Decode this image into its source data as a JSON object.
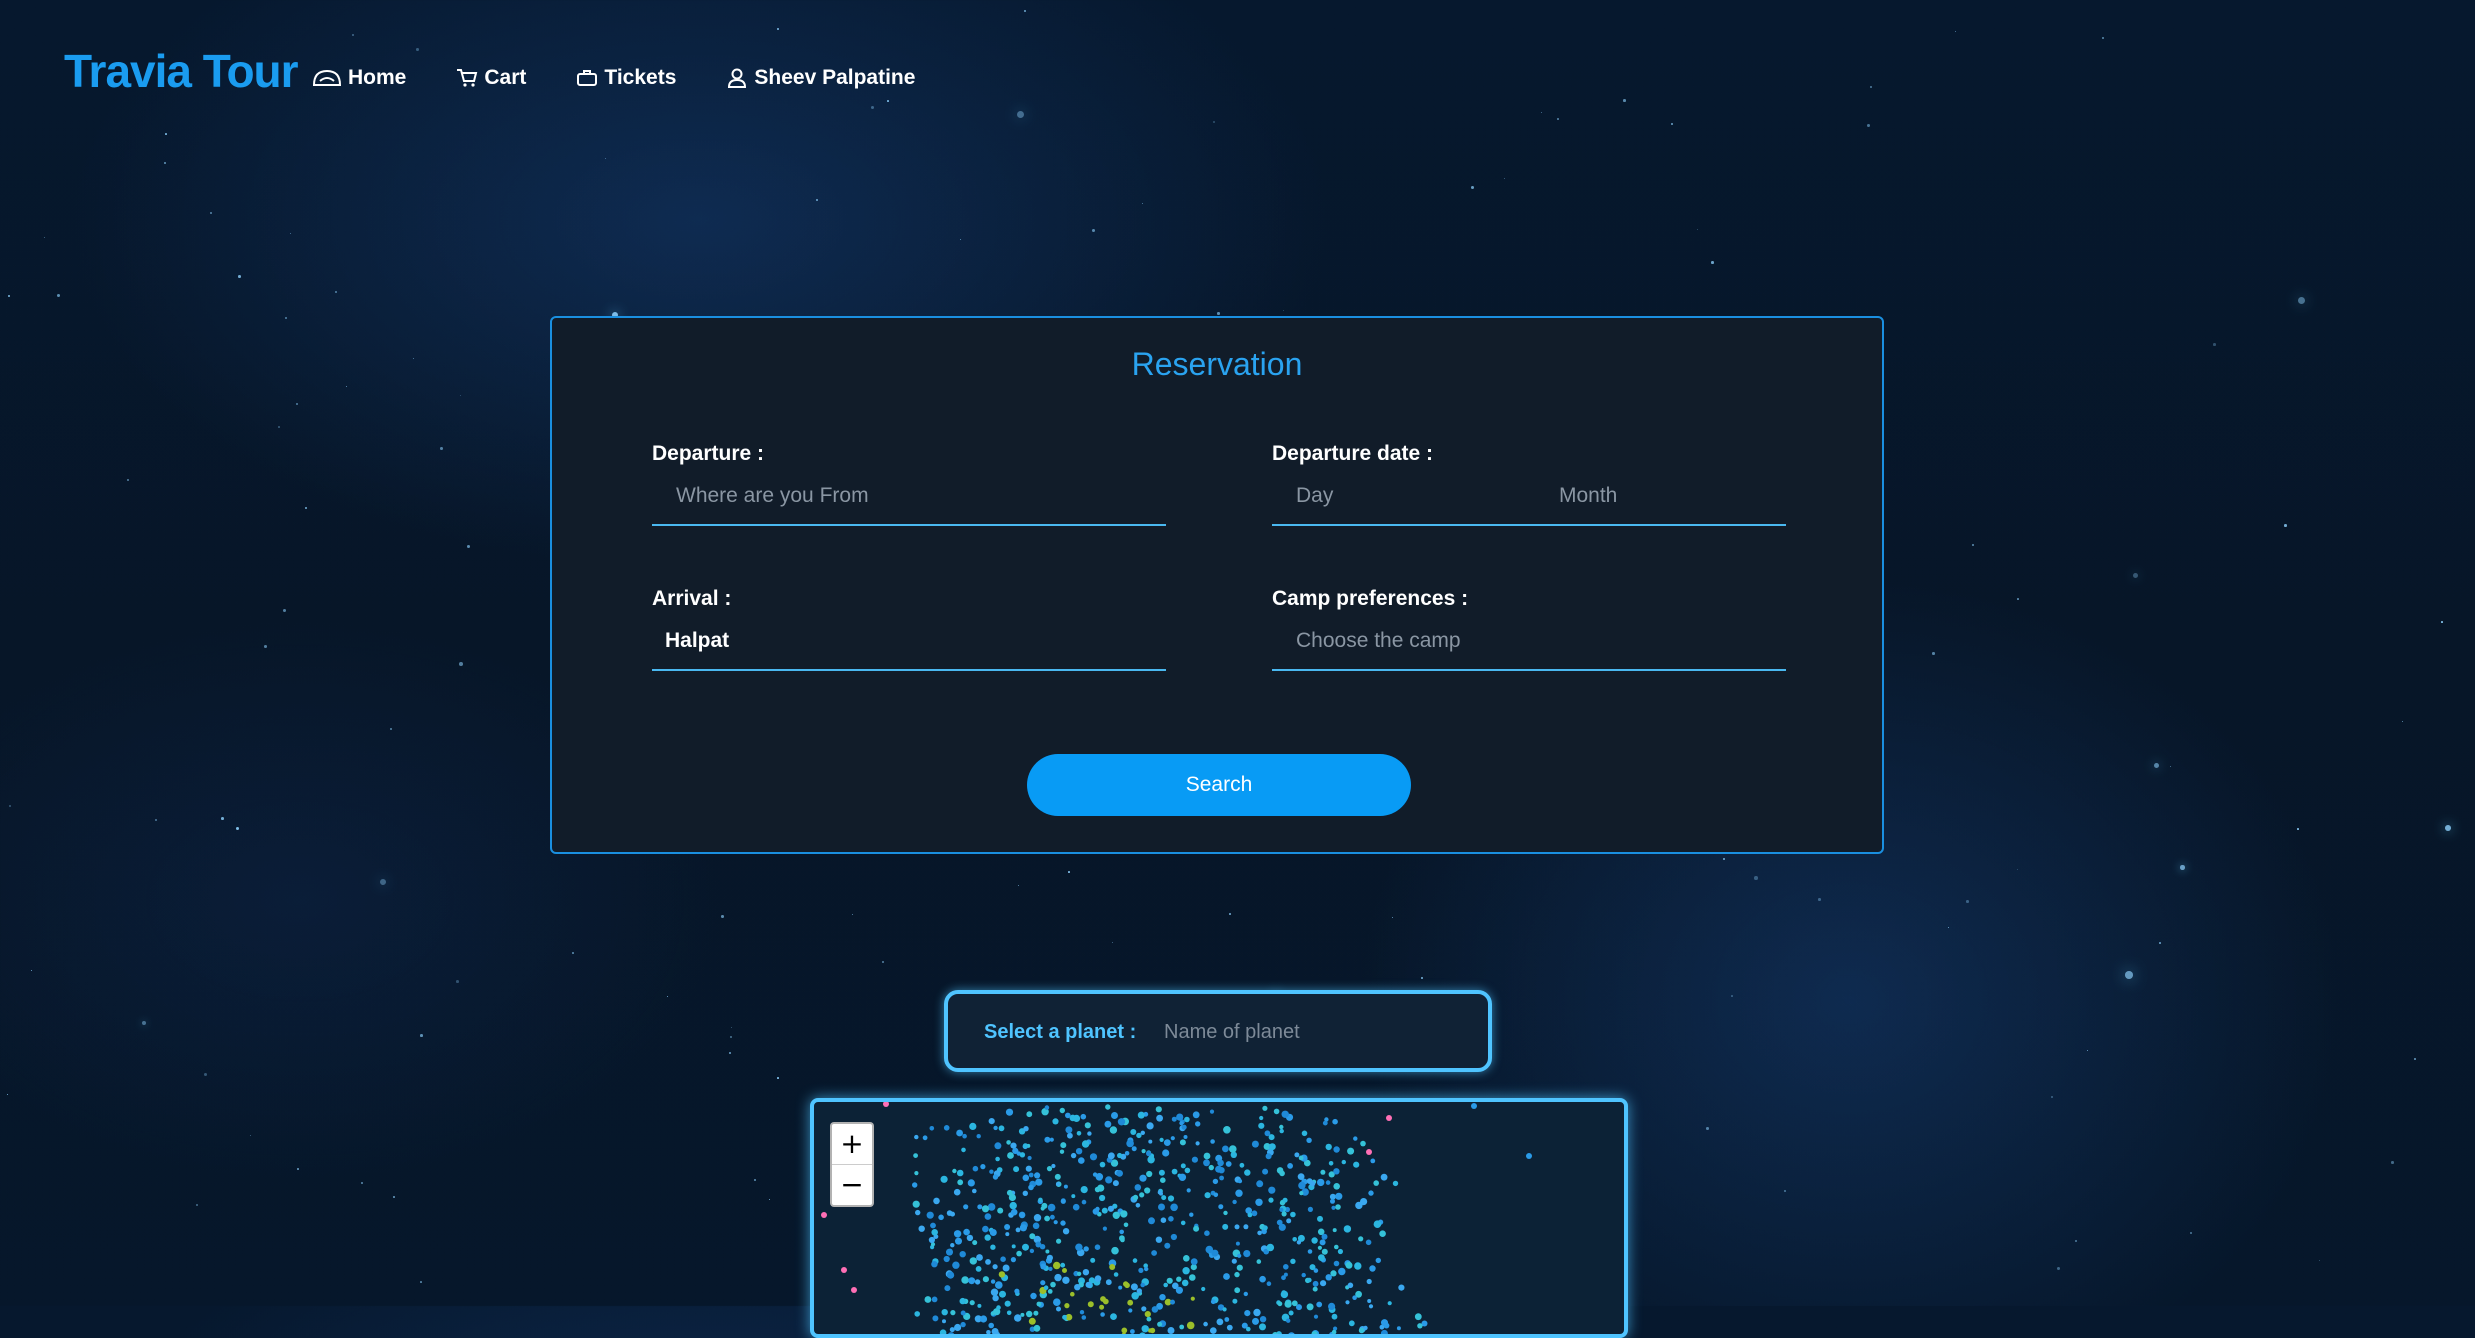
{
  "brand": {
    "name": "Travia Tour"
  },
  "nav": [
    {
      "label": "Home",
      "icon": "helmet-icon"
    },
    {
      "label": "Cart",
      "icon": "cart-icon"
    },
    {
      "label": "Tickets",
      "icon": "briefcase-icon"
    },
    {
      "label": "Sheev Palpatine",
      "icon": "user-icon"
    }
  ],
  "reservation": {
    "title": "Reservation",
    "departure": {
      "label": "Departure :",
      "placeholder": "Where are you From"
    },
    "departure_date": {
      "label": "Departure date :",
      "day_placeholder": "Day",
      "month_placeholder": "Month"
    },
    "arrival": {
      "label": "Arrival :",
      "value": "Halpat"
    },
    "camp": {
      "label": "Camp preferences :",
      "placeholder": "Choose the camp"
    },
    "search_label": "Search"
  },
  "planet_select": {
    "label": "Select a planet :",
    "placeholder": "Name of planet"
  },
  "map": {
    "zoom_in": "+",
    "zoom_out": "−"
  },
  "colors": {
    "accent": "#1a9cf0",
    "button": "#089bf5",
    "glow": "#4fc4ff",
    "card_bg": "#111c29"
  }
}
